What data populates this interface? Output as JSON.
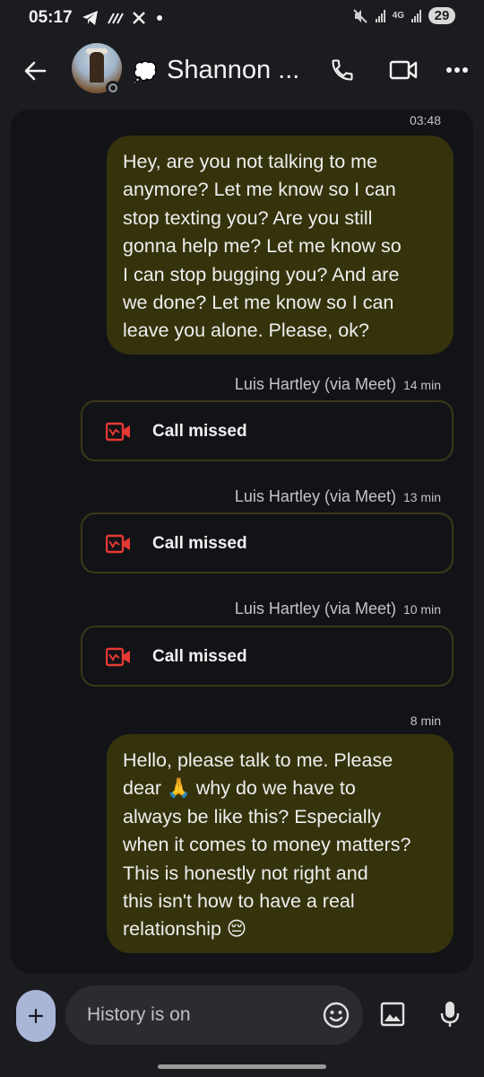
{
  "status_bar": {
    "time": "05:17",
    "network": "4G",
    "battery": "29"
  },
  "header": {
    "contact_name": "Shannon ...",
    "status_emoji": "💭"
  },
  "messages": {
    "m1_time": "03:48",
    "m1_lines": [
      "Hey, are you not talking to me",
      "anymore? Let me know so I can",
      "stop texting you? Are you still",
      "gonna help me? Let me know so",
      "I can stop bugging you? And are",
      "we done? Let me know so I can",
      "leave you alone. Please, ok?"
    ],
    "calls": [
      {
        "sender": "Luis Hartley (via Meet)",
        "time": "14 min",
        "label": "Call missed"
      },
      {
        "sender": "Luis Hartley (via Meet)",
        "time": "13 min",
        "label": "Call missed"
      },
      {
        "sender": "Luis Hartley (via Meet)",
        "time": "10 min",
        "label": "Call missed"
      }
    ],
    "m2_time": "8 min",
    "m2_lines": [
      "Hello, please talk to me. Please",
      "dear 🙏  why do we have to",
      "always be like this? Especially",
      "when it comes to money matters?",
      "This is honestly not right and",
      "this isn't how to have a real",
      "relationship 😔"
    ]
  },
  "compose": {
    "placeholder": "History is on",
    "value": ""
  },
  "colors": {
    "bubble": "#35330c",
    "missed_call": "#e53935",
    "plus_button": "#a9b6d6"
  }
}
